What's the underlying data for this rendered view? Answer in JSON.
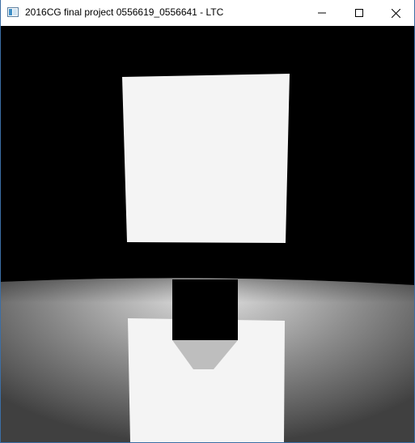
{
  "window": {
    "title": "2016CG final project 0556619_0556641 - LTC",
    "icon": "app-window-icon",
    "controls": {
      "minimize_icon": "minimize-icon",
      "maximize_icon": "maximize-icon",
      "close_icon": "close-icon"
    }
  },
  "scene": {
    "background_color": "#000000",
    "light_panel_color": "#f4f4f4",
    "floor_highlight_color": "#e8e8e8",
    "floor_shadow_color": "#404040"
  }
}
